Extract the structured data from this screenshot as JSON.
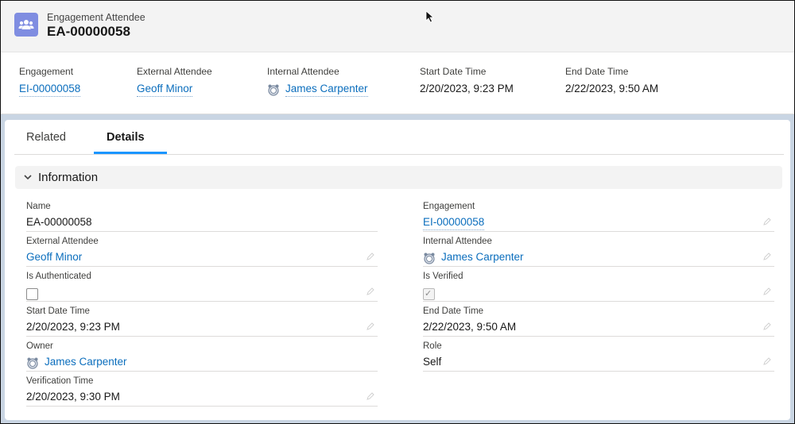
{
  "header": {
    "object_type": "Engagement Attendee",
    "record_name": "EA-00000058",
    "highlights": [
      {
        "label": "Engagement",
        "value": "EI-00000058"
      },
      {
        "label": "External Attendee",
        "value": "Geoff Minor"
      },
      {
        "label": "Internal Attendee",
        "value": "James Carpenter"
      },
      {
        "label": "Start Date Time",
        "value": "2/20/2023, 9:23 PM"
      },
      {
        "label": "End Date Time",
        "value": "2/22/2023, 9:50 AM"
      }
    ]
  },
  "tabs": [
    {
      "label": "Related"
    },
    {
      "label": "Details"
    }
  ],
  "section": {
    "title": "Information"
  },
  "fields": {
    "name": {
      "label": "Name",
      "value": "EA-00000058"
    },
    "engagement": {
      "label": "Engagement",
      "value": "EI-00000058"
    },
    "external_attendee": {
      "label": "External Attendee",
      "value": "Geoff Minor"
    },
    "internal_attendee": {
      "label": "Internal Attendee",
      "value": "James Carpenter"
    },
    "is_authenticated": {
      "label": "Is Authenticated",
      "checked": false
    },
    "is_verified": {
      "label": "Is Verified",
      "checked": true
    },
    "start_date_time": {
      "label": "Start Date Time",
      "value": "2/20/2023, 9:23 PM"
    },
    "end_date_time": {
      "label": "End Date Time",
      "value": "2/22/2023, 9:50 AM"
    },
    "owner": {
      "label": "Owner",
      "value": "James Carpenter"
    },
    "role": {
      "label": "Role",
      "value": "Self"
    },
    "verification_time": {
      "label": "Verification Time",
      "value": "2/20/2023, 9:30 PM"
    }
  },
  "colors": {
    "link": "#0b6ebd",
    "accent": "#1b96ff",
    "object_icon": "#7f8de1"
  }
}
